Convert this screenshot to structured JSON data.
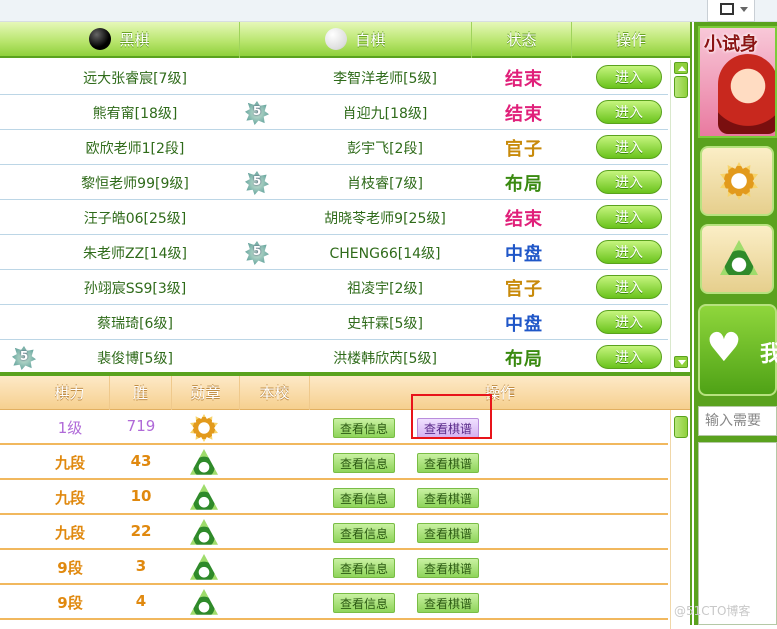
{
  "upper": {
    "headers": [
      "黑棋",
      "白棋",
      "状态",
      "操作"
    ],
    "rows": [
      {
        "black": "远大张睿宸[7级]",
        "white": "李智洋老师[5级]",
        "status": "结束",
        "status_kind": "end",
        "badge": "",
        "action": "进入"
      },
      {
        "black": "熊宥甯[18级]",
        "white": "肖迎九[18级]",
        "status": "结束",
        "status_kind": "end",
        "badge": "5",
        "action": "进入"
      },
      {
        "black": "欧欣老师1[2段]",
        "white": "彭宇飞[2段]",
        "status": "官子",
        "status_kind": "gz",
        "badge": "",
        "action": "进入"
      },
      {
        "black": "黎恒老师99[9级]",
        "white": "肖枝睿[7级]",
        "status": "布局",
        "status_kind": "bj",
        "badge": "5",
        "action": "进入"
      },
      {
        "black": "汪子皓06[25级]",
        "white": "胡晓苓老师9[25级]",
        "status": "结束",
        "status_kind": "end",
        "badge": "",
        "action": "进入"
      },
      {
        "black": "朱老师ZZ[14级]",
        "white": "CHENG66[14级]",
        "status": "中盘",
        "status_kind": "zp",
        "badge": "5",
        "action": "进入"
      },
      {
        "black": "孙翊宸SS9[3级]",
        "white": "祖凌宇[2级]",
        "status": "官子",
        "status_kind": "gz",
        "badge": "",
        "action": "进入"
      },
      {
        "black": "蔡瑞琦[6级]",
        "white": "史轩霖[5级]",
        "status": "中盘",
        "status_kind": "zp",
        "badge": "",
        "action": "进入"
      },
      {
        "black": "裴俊博[5级]",
        "white": "洪楼韩欣芮[5级]",
        "status": "布局",
        "status_kind": "bj",
        "badge": "5",
        "action": "进入"
      }
    ]
  },
  "lower": {
    "headers": [
      "棋力",
      "胜",
      "勋章",
      "本校",
      "操作"
    ],
    "info_label": "查看信息",
    "record_label": "查看棋谱",
    "rows": [
      {
        "rank": "1级",
        "wins": "719",
        "medal": "sun-medal-icon",
        "highlight": true
      },
      {
        "rank": "九段",
        "wins": "43",
        "medal": "triangle-medal-icon",
        "highlight": false
      },
      {
        "rank": "九段",
        "wins": "10",
        "medal": "triangle-medal-icon",
        "highlight": false
      },
      {
        "rank": "九段",
        "wins": "22",
        "medal": "triangle-medal-icon",
        "highlight": false
      },
      {
        "rank": "9段",
        "wins": "3",
        "medal": "triangle-medal-icon",
        "highlight": false
      },
      {
        "rank": "9段",
        "wins": "4",
        "medal": "triangle-medal-icon",
        "highlight": false
      }
    ]
  },
  "side": {
    "promo_title": "小试身",
    "heart_text": "我",
    "search_placeholder": "输入需要"
  },
  "watermark": "@51CTO博客",
  "colors": {
    "green": "#5aa21e",
    "status_end": "#e0207a",
    "status_gz": "#c88a0a",
    "status_bj": "#3a8a10",
    "status_zp": "#2057c8",
    "highlight_box": "#e8141a"
  }
}
